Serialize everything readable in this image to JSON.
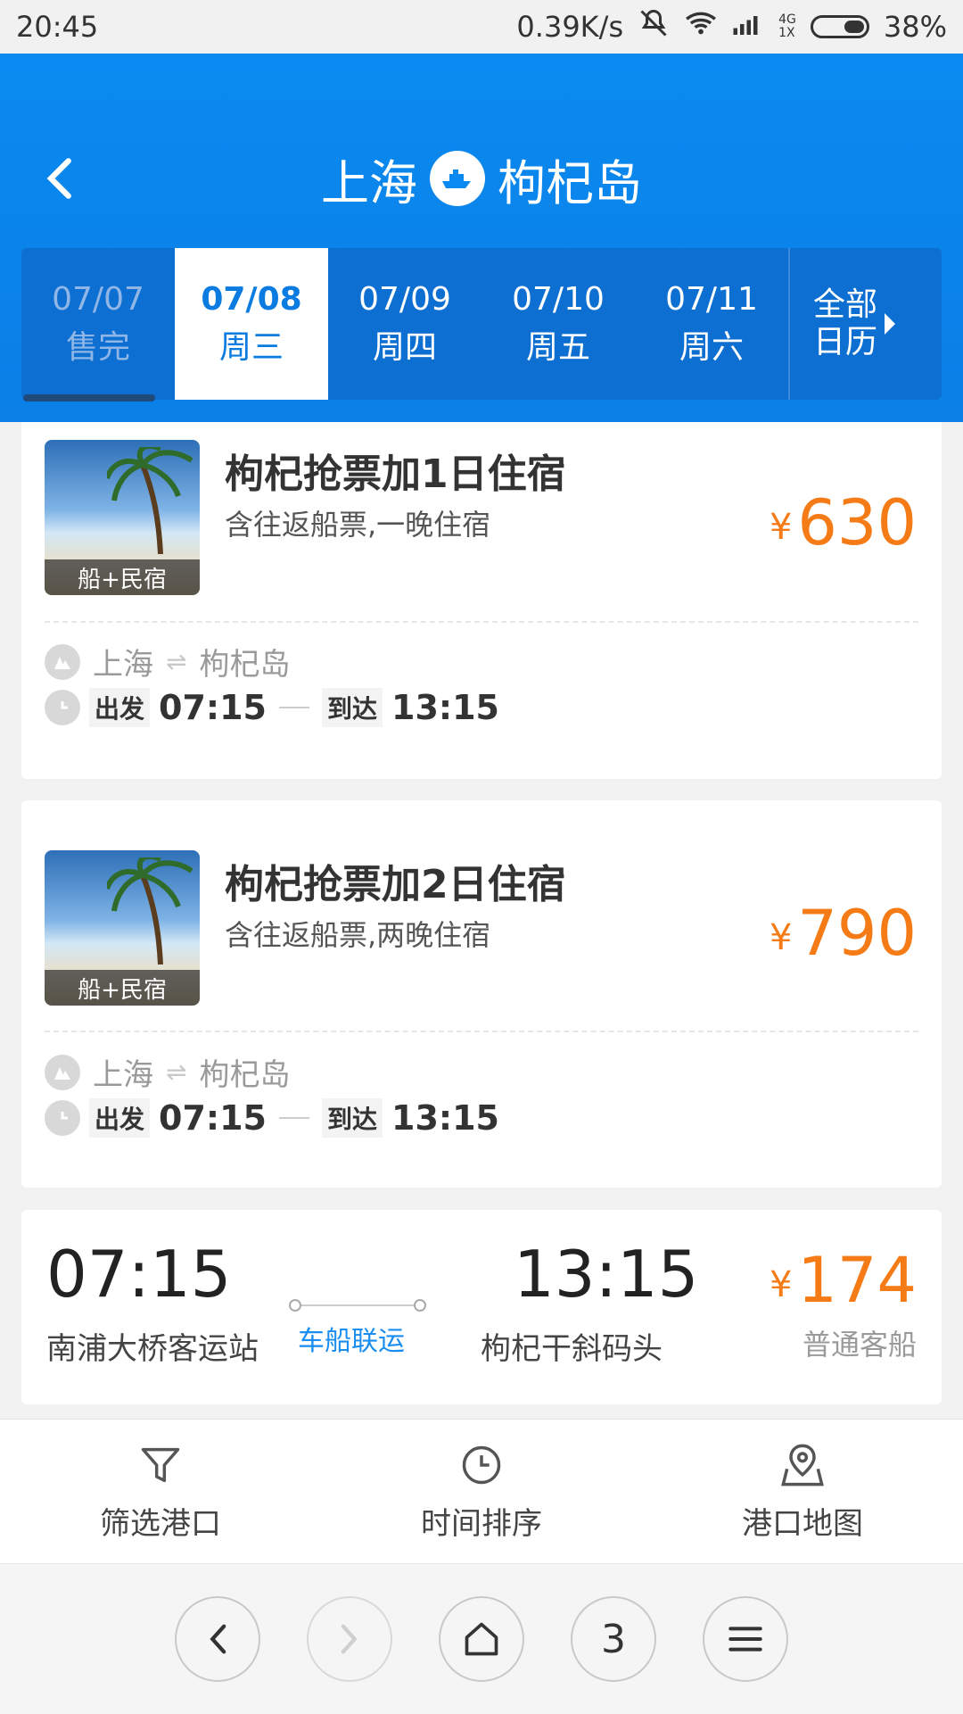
{
  "status_bar": {
    "time": "20:45",
    "speed": "0.39K/s",
    "network": "4G",
    "network2": "1X",
    "battery": "38%"
  },
  "header": {
    "from": "上海",
    "to": "枸杞岛",
    "dates": [
      {
        "date": "07/07",
        "label": "售完",
        "state": "soldout"
      },
      {
        "date": "07/08",
        "label": "周三",
        "state": "active"
      },
      {
        "date": "07/09",
        "label": "周四",
        "state": "normal"
      },
      {
        "date": "07/10",
        "label": "周五",
        "state": "normal"
      },
      {
        "date": "07/11",
        "label": "周六",
        "state": "normal"
      }
    ],
    "more_line1": "全部",
    "more_line2": "日历"
  },
  "packages": [
    {
      "title": "枸杞抢票加1日住宿",
      "subtitle": "含往返船票,一晚住宿",
      "price": "630",
      "currency": "¥",
      "thumb_caption": "船+民宿",
      "route_from": "上海",
      "route_to": "枸杞岛",
      "depart_label": "出发",
      "depart_time": "07:15",
      "arrive_label": "到达",
      "arrive_time": "13:15"
    },
    {
      "title": "枸杞抢票加2日住宿",
      "subtitle": "含往返船票,两晚住宿",
      "price": "790",
      "currency": "¥",
      "thumb_caption": "船+民宿",
      "route_from": "上海",
      "route_to": "枸杞岛",
      "depart_label": "出发",
      "depart_time": "07:15",
      "arrive_label": "到达",
      "arrive_time": "13:15"
    }
  ],
  "schedule": {
    "depart_time": "07:15",
    "depart_station": "南浦大桥客运站",
    "combo_label": "车船联运",
    "arrive_time": "13:15",
    "arrive_station": "枸杞干斜码头",
    "price": "174",
    "currency": "¥",
    "ship_type": "普通客船"
  },
  "toolbar": {
    "filter_label": "筛选港口",
    "sort_label": "时间排序",
    "map_label": "港口地图"
  },
  "browser": {
    "tab_count": "3"
  }
}
